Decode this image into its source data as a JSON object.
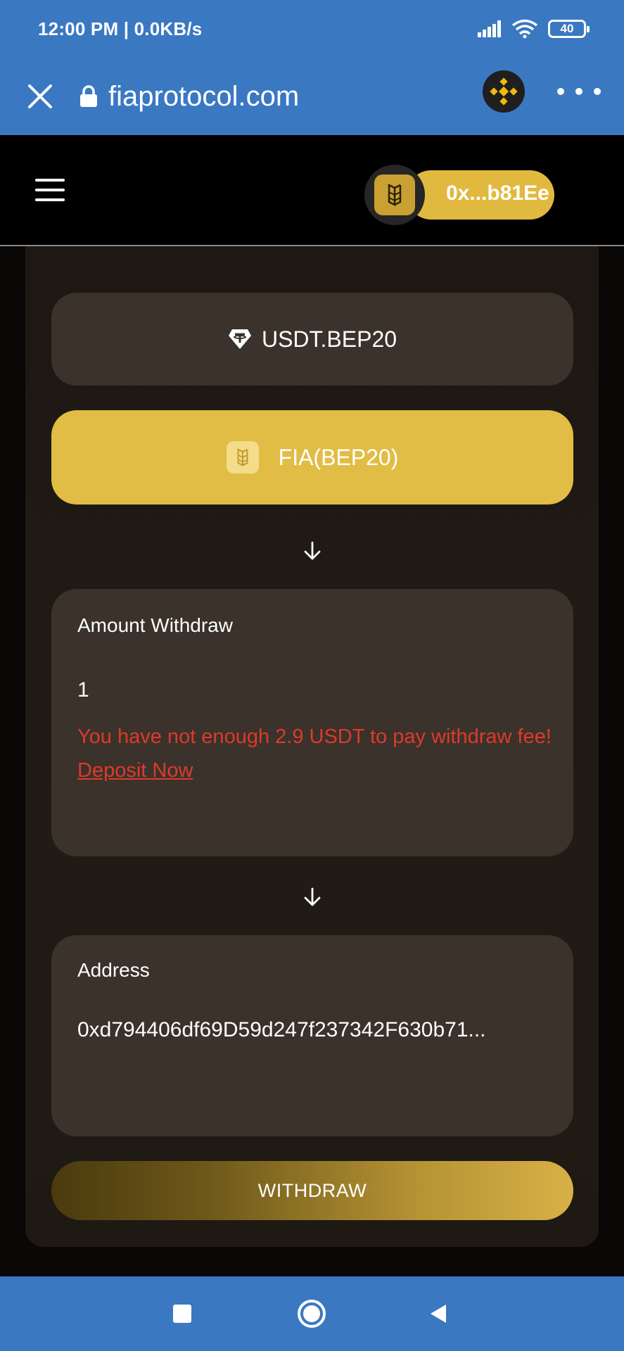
{
  "status_bar": {
    "time_speed": "12:00 PM | 0.0KB/s",
    "battery": "40",
    "icons": [
      "signal-icon",
      "wifi-icon",
      "battery-icon"
    ]
  },
  "browser": {
    "url": "fiaprotocol.com",
    "icons": [
      "close-icon",
      "lock-icon",
      "binance-icon",
      "more-icon"
    ]
  },
  "header": {
    "wallet_address": "0x...b81Ee"
  },
  "tokens": {
    "usdt_label": "USDT.BEP20",
    "fia_label": "FIA(BEP20)"
  },
  "amount": {
    "label": "Amount Withdraw",
    "value": "1",
    "error_text": "You have not enough 2.9 USDT to pay withdraw fee!",
    "deposit_link": "Deposit Now"
  },
  "address": {
    "label": "Address",
    "value": "0xd794406df69D59d247f237342F630b71..."
  },
  "withdraw": {
    "label": "WITHDRAW"
  },
  "colors": {
    "browser_blue": "#3a78c2",
    "gold": "#e1bd45",
    "card_bg": "#3a322b",
    "error_red": "#dd3a2c"
  }
}
